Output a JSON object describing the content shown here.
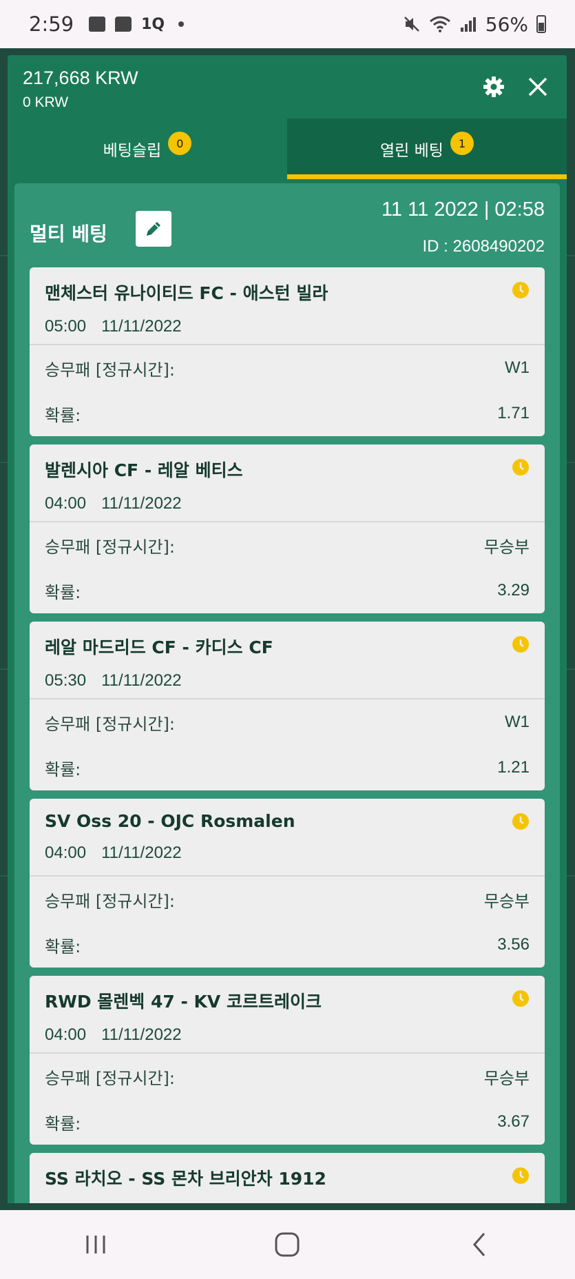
{
  "status_bar": {
    "time": "2:59",
    "carrier_label": "1Q",
    "battery": "56%"
  },
  "header": {
    "balance": "217,668 KRW",
    "bonus_balance": "0 KRW"
  },
  "tabs": [
    {
      "label": "베팅슬립",
      "count": "0",
      "active": false
    },
    {
      "label": "열린 베팅",
      "count": "1",
      "active": true
    }
  ],
  "bet": {
    "title": "멀티 베팅",
    "datetime": "11 11 2022 | 02:58",
    "id_text": "ID :  2608490202",
    "market_label": "승무패 [정규시간]:",
    "odds_label": "확률:",
    "selections": [
      {
        "teams": "맨체스터 유나이티드 FC - 애스턴 빌라",
        "time": "05:00",
        "date": "11/11/2022",
        "pick": "W1",
        "odds": "1.71"
      },
      {
        "teams": "발렌시아 CF - 레알 베티스",
        "time": "04:00",
        "date": "11/11/2022",
        "pick": "무승부",
        "odds": "3.29"
      },
      {
        "teams": "레알 마드리드 CF - 카디스 CF",
        "time": "05:30",
        "date": "11/11/2022",
        "pick": "W1",
        "odds": "1.21"
      },
      {
        "teams": "SV Oss 20 - OJC Rosmalen",
        "time": "04:00",
        "date": "11/11/2022",
        "pick": "무승부",
        "odds": "3.56"
      },
      {
        "teams": "RWD 몰렌벡 47 - KV 코르트레이크",
        "time": "04:00",
        "date": "11/11/2022",
        "pick": "무승부",
        "odds": "3.67"
      },
      {
        "teams": "SS 라치오 - SS 몬차 브리안차 1912",
        "time": "",
        "date": "",
        "pick": "",
        "odds": ""
      }
    ]
  },
  "colors": {
    "primary_green": "#1a7a58",
    "content_green": "#329575",
    "accent_yellow": "#f5c400"
  },
  "icons": {
    "settings": "gear-icon",
    "close": "close-icon",
    "edit": "pencil-icon",
    "pending": "clock-icon"
  }
}
